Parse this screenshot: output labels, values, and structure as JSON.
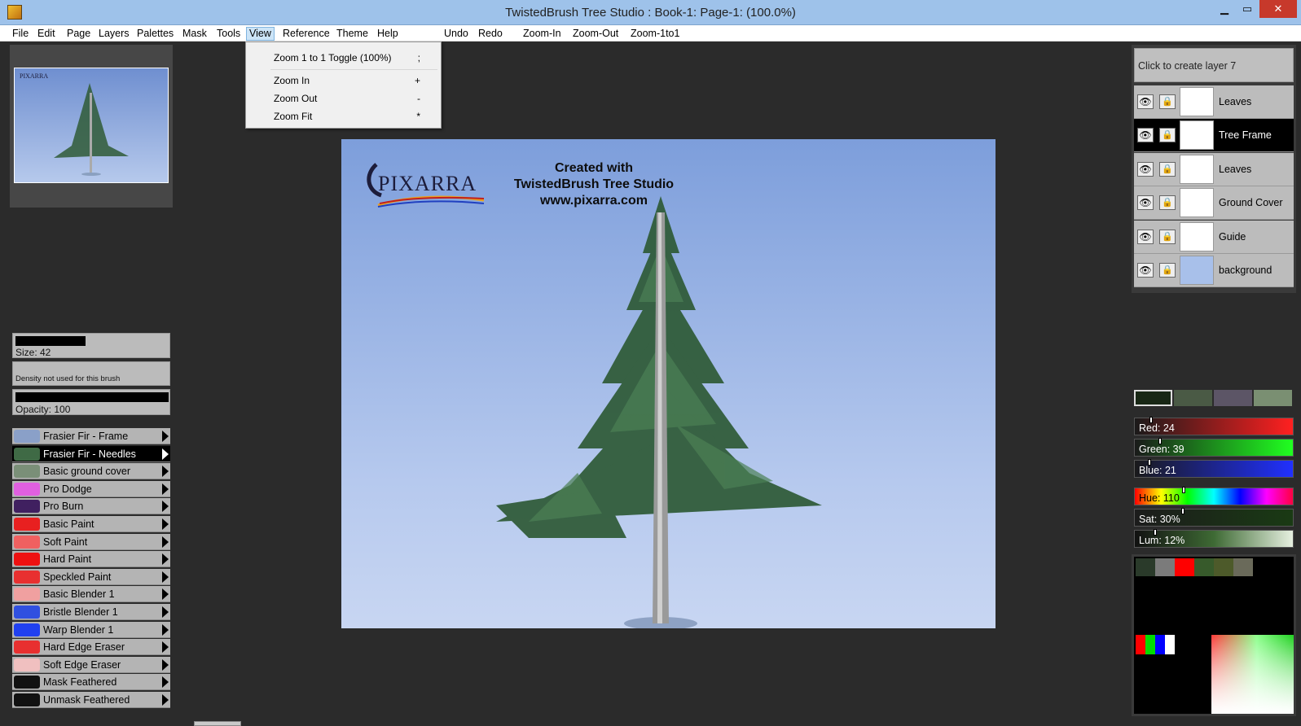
{
  "window": {
    "title": "TwistedBrush Tree Studio : Book-1: Page-1:  (100.0%)",
    "min_glyph": "▁",
    "max_glyph": "▭",
    "close_glyph": "✕"
  },
  "menu": {
    "items": [
      "File",
      "Edit",
      "Page",
      "Layers",
      "Palettes",
      "Mask",
      "Tools",
      "View",
      "Reference",
      "Theme",
      "Help"
    ],
    "actions": [
      "Undo",
      "Redo",
      "Zoom-In",
      "Zoom-Out",
      "Zoom-1to1"
    ],
    "active": "View"
  },
  "view_menu": {
    "items": [
      {
        "label": "Zoom 1 to 1 Toggle (100%)",
        "shortcut": ";"
      },
      {
        "label": "Zoom In",
        "shortcut": "+"
      },
      {
        "label": "Zoom Out",
        "shortcut": "-"
      },
      {
        "label": "Zoom Fit",
        "shortcut": "*"
      }
    ]
  },
  "brush_props": {
    "size_label": "Size: 42",
    "density_label": "Density not used for this brush",
    "opacity_label": "Opacity: 100"
  },
  "brushes": [
    {
      "name": "Frasier Fir - Frame",
      "selected": false,
      "color": "#8aa0c8"
    },
    {
      "name": "Frasier Fir - Needles",
      "selected": true,
      "color": "#3f6a45"
    },
    {
      "name": "Basic ground cover",
      "selected": false,
      "color": "#7a8f78"
    },
    {
      "name": "Pro Dodge",
      "selected": false,
      "color": "#e060e0"
    },
    {
      "name": "Pro Burn",
      "selected": false,
      "color": "#402060"
    },
    {
      "name": "Basic Paint",
      "selected": false,
      "color": "#e82020"
    },
    {
      "name": "Soft Paint",
      "selected": false,
      "color": "#f06060"
    },
    {
      "name": "Hard Paint",
      "selected": false,
      "color": "#ee1111"
    },
    {
      "name": "Speckled Paint",
      "selected": false,
      "color": "#e83030"
    },
    {
      "name": "Basic Blender 1",
      "selected": false,
      "color": "#f0a0a0"
    },
    {
      "name": "Bristle Blender 1",
      "selected": false,
      "color": "#3050e0"
    },
    {
      "name": "Warp Blender 1",
      "selected": false,
      "color": "#2040f0"
    },
    {
      "name": "Hard Edge Eraser",
      "selected": false,
      "color": "#e83030"
    },
    {
      "name": "Soft Edge Eraser",
      "selected": false,
      "color": "#f0c0c0"
    },
    {
      "name": "Mask Feathered",
      "selected": false,
      "color": "#111111"
    },
    {
      "name": "Unmask Feathered",
      "selected": false,
      "color": "#111111"
    }
  ],
  "canvas": {
    "logo_text": "PIXARRA",
    "created_lines": [
      "Created with",
      "TwistedBrush Tree Studio",
      "www.pixarra.com"
    ]
  },
  "thumbnail": {
    "logo_text": "PIXARRA"
  },
  "layers": {
    "new_layer_label": "Click to create layer 7",
    "eye_glyph": "👁",
    "lock_glyph": "🔒",
    "items": [
      {
        "name": "Leaves",
        "selected": false,
        "thumb": "#ffffff"
      },
      {
        "name": "Tree Frame",
        "selected": true,
        "thumb": "#ffffff"
      },
      {
        "name": "Leaves",
        "selected": false,
        "thumb": "#ffffff"
      },
      {
        "name": "Ground Cover",
        "selected": false,
        "thumb": "#ffffff"
      },
      {
        "name": "Guide",
        "selected": false,
        "thumb": "#ffffff"
      },
      {
        "name": "background",
        "selected": false,
        "thumb": "#a8c0ea"
      }
    ]
  },
  "color": {
    "swatches": [
      "#182715",
      "#4a5a45",
      "#5c5566",
      "#7a8f72"
    ],
    "rgb": [
      {
        "label": "Red: 24",
        "value": 24
      },
      {
        "label": "Green: 39",
        "value": 39
      },
      {
        "label": "Blue: 21",
        "value": 21
      }
    ],
    "hsl": [
      {
        "label": "Hue: 110",
        "value": 110
      },
      {
        "label": "Sat: 30%",
        "value": 30
      },
      {
        "label": "Lum: 12%",
        "value": 12
      }
    ],
    "palette_colors": [
      "#2a3a2a",
      "#7b7b7b",
      "#ff0000",
      "#375a2b",
      "#4d5a2a",
      "#6a6a5a"
    ],
    "primary_swatches": [
      "#ff0000",
      "#00dd00",
      "#0000ff",
      "#ffffff"
    ]
  }
}
